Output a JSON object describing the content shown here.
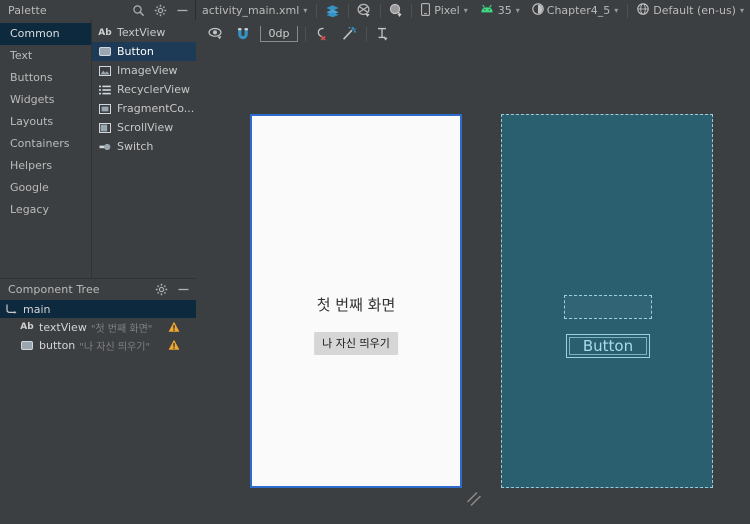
{
  "palette": {
    "title": "Palette",
    "icons": [
      {
        "name": "search-icon"
      },
      {
        "name": "gear-icon"
      },
      {
        "name": "minimize-icon"
      }
    ],
    "categories": [
      {
        "label": "Common",
        "selected": true
      },
      {
        "label": "Text",
        "selected": false
      },
      {
        "label": "Buttons",
        "selected": false
      },
      {
        "label": "Widgets",
        "selected": false
      },
      {
        "label": "Layouts",
        "selected": false
      },
      {
        "label": "Containers",
        "selected": false
      },
      {
        "label": "Helpers",
        "selected": false
      },
      {
        "label": "Google",
        "selected": false
      },
      {
        "label": "Legacy",
        "selected": false
      }
    ],
    "widgets": [
      {
        "label": "TextView",
        "icon": "text-view-icon",
        "selected": false
      },
      {
        "label": "Button",
        "icon": "button-icon",
        "selected": true
      },
      {
        "label": "ImageView",
        "icon": "image-view-icon",
        "selected": false
      },
      {
        "label": "RecyclerView",
        "icon": "recycler-view-icon",
        "selected": false
      },
      {
        "label": "FragmentCo...",
        "icon": "fragment-container-icon",
        "selected": false
      },
      {
        "label": "ScrollView",
        "icon": "scroll-view-icon",
        "selected": false
      },
      {
        "label": "Switch",
        "icon": "switch-icon",
        "selected": false
      }
    ]
  },
  "component_tree": {
    "title": "Component Tree",
    "icons": [
      {
        "name": "gear-icon"
      },
      {
        "name": "minimize-icon"
      }
    ],
    "nodes": [
      {
        "label": "main",
        "attr": "",
        "selected": true,
        "warning": false
      },
      {
        "label": "textView",
        "attr": "\"첫 번째 화면\"",
        "selected": false,
        "warning": true
      },
      {
        "label": "button",
        "attr": "\"나 자신 띄우기\"",
        "selected": false,
        "warning": true
      }
    ]
  },
  "toolbar": {
    "file_name": "activity_main.xml",
    "view_modes": [
      {
        "name": "design-surface-icon",
        "active": true
      },
      {
        "name": "blueprint-toggle-icon",
        "active": false
      },
      {
        "name": "zoom-controls-icon",
        "active": false
      }
    ],
    "device": "Pixel",
    "api_level": "35",
    "theme": "Chapter4_5",
    "locale": "Default (en-us)",
    "second_row": {
      "view_options_label": "view-options-icon",
      "magnet_label": "autoconnect-magnet-icon",
      "default_margin": "0dp",
      "clear_constraints_label": "clear-constraints-icon",
      "infer_constraints_label": "infer-constraints-icon",
      "guidelines_label": "guidelines-icon"
    }
  },
  "canvas": {
    "device_preview": {
      "title_text": "첫 번째 화면",
      "button_text": "나 자신 띄우기"
    },
    "blueprint": {
      "button_text": "Button"
    }
  },
  "colors": {
    "panel_bg": "#3c3f41",
    "selection_blue": "#0d293e",
    "widget_selection": "#1d3a56",
    "accent_blue": "#2d6ccd",
    "blueprint_teal": "#2a5f70",
    "blueprint_line": "#9fd0dd",
    "warning_amber": "#f0a732"
  }
}
